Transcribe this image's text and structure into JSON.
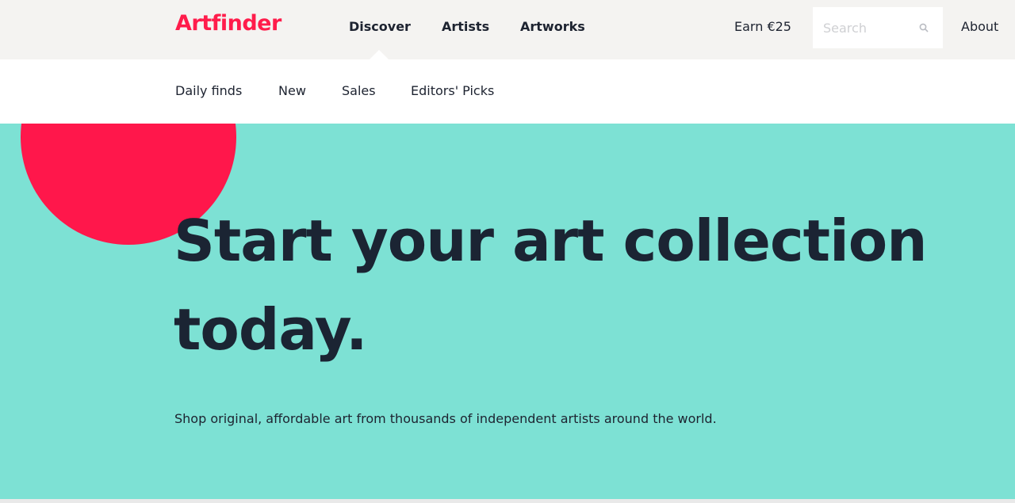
{
  "header": {
    "logo": "Artfinder",
    "nav": [
      {
        "label": "Discover"
      },
      {
        "label": "Artists"
      },
      {
        "label": "Artworks"
      }
    ],
    "earn_label": "Earn €25",
    "search": {
      "placeholder": "Search",
      "icon": "search-icon"
    },
    "about_label": "About"
  },
  "subnav": {
    "items": [
      {
        "label": "Daily finds"
      },
      {
        "label": "New"
      },
      {
        "label": "Sales"
      },
      {
        "label": "Editors' Picks"
      }
    ]
  },
  "hero": {
    "headline": "Start your art collection today.",
    "tagline": "Shop original, affordable art from thousands of independent artists around the world."
  },
  "colors": {
    "brand": "#ff1c4b",
    "hero_background": "#7de1d4",
    "topbar_background": "#f4f3f1",
    "text": "#1d2330"
  }
}
